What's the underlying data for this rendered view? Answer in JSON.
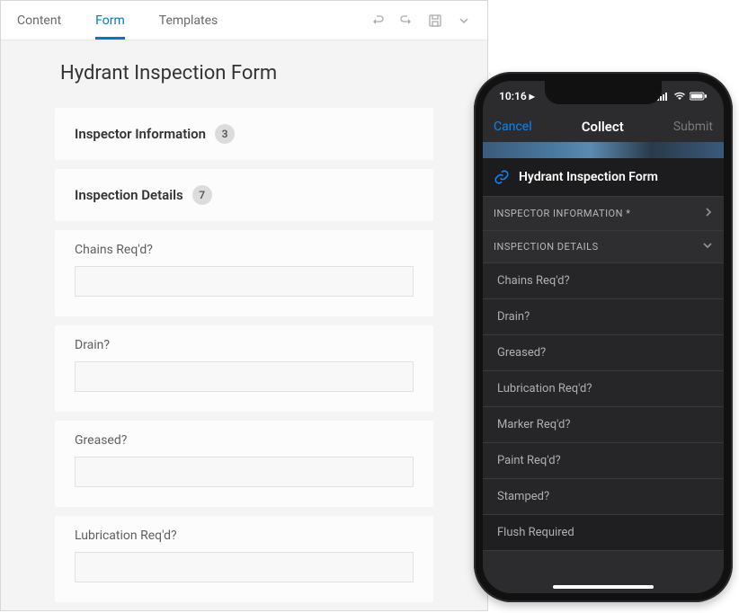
{
  "desktop": {
    "tabs": [
      {
        "label": "Content",
        "active": false
      },
      {
        "label": "Form",
        "active": true
      },
      {
        "label": "Templates",
        "active": false
      }
    ],
    "form_title": "Hydrant Inspection Form",
    "sections": [
      {
        "title": "Inspector Information",
        "count": "3"
      },
      {
        "title": "Inspection Details",
        "count": "7"
      }
    ],
    "fields": [
      {
        "label": "Chains Req'd?"
      },
      {
        "label": "Drain?"
      },
      {
        "label": "Greased?"
      },
      {
        "label": "Lubrication Req'd?"
      }
    ]
  },
  "phone": {
    "time": "10:16",
    "nav": {
      "cancel": "Cancel",
      "title": "Collect",
      "submit": "Submit"
    },
    "form_title": "Hydrant Inspection Form",
    "section_rows": [
      {
        "label": "INSPECTOR INFORMATION *",
        "chevron": "right"
      },
      {
        "label": "INSPECTION DETAILS",
        "chevron": "down"
      }
    ],
    "field_rows": [
      "Chains Req'd?",
      "Drain?",
      "Greased?",
      "Lubrication Req'd?",
      "Marker Req'd?",
      "Paint Req'd?",
      "Stamped?",
      "Flush Required"
    ]
  }
}
